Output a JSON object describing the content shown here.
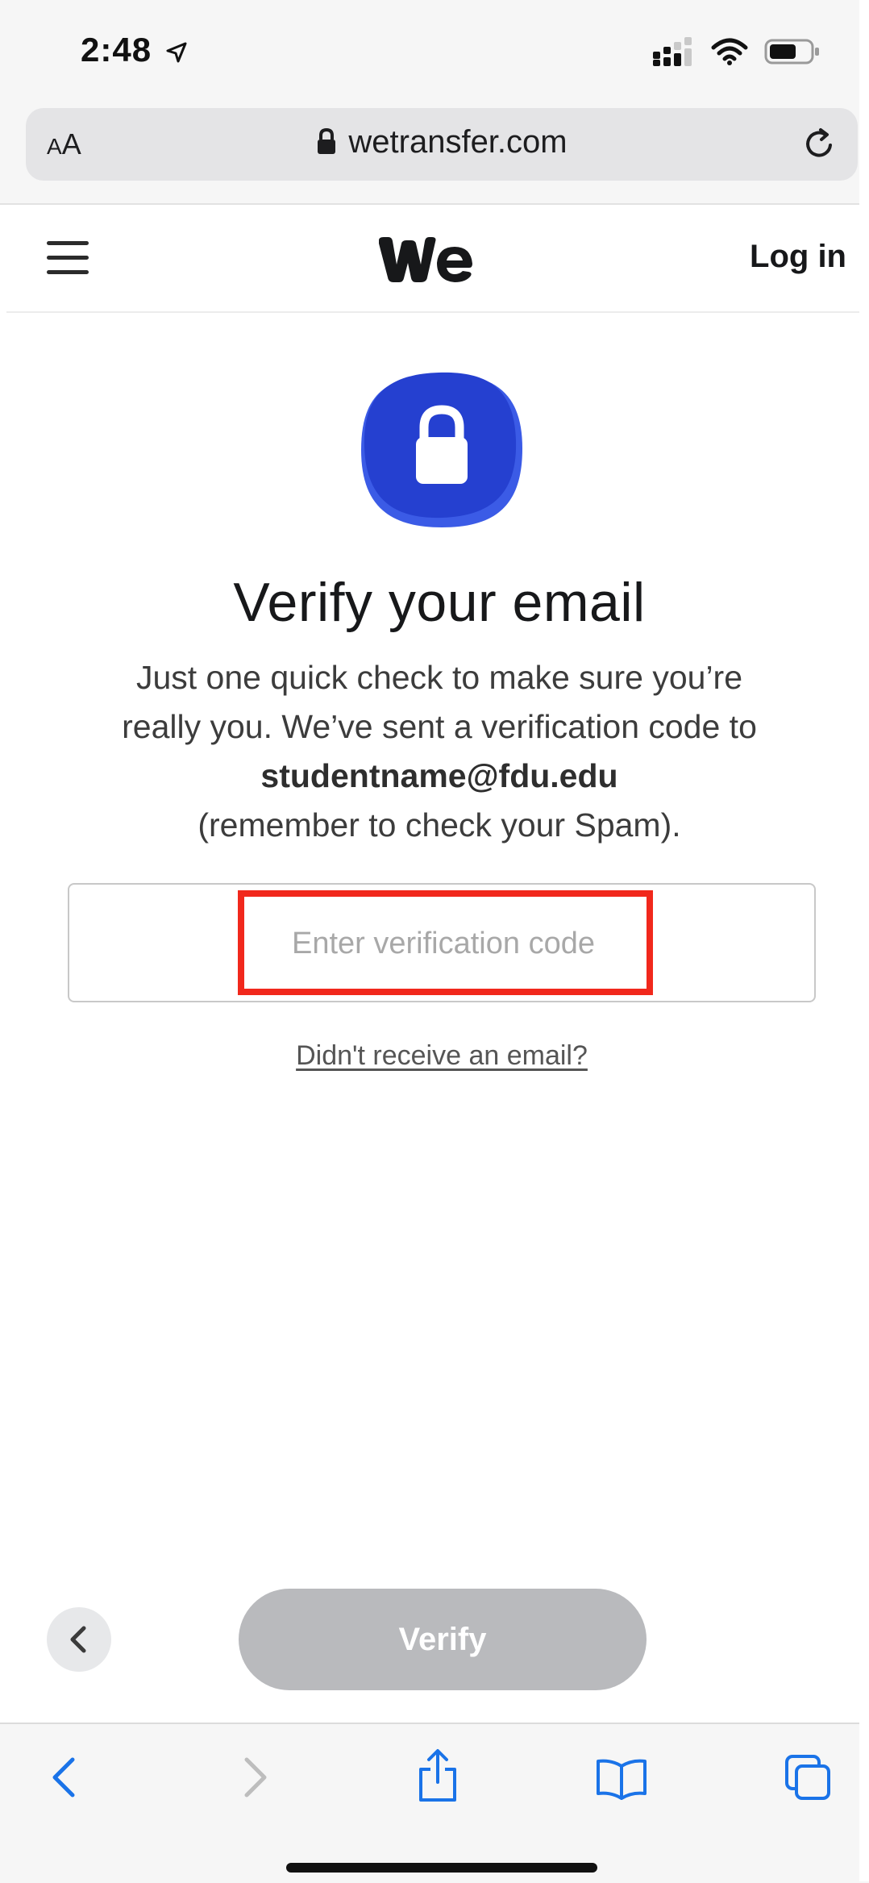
{
  "status_bar": {
    "time": "2:48"
  },
  "browser": {
    "text_size_label_small": "A",
    "text_size_label_large": "A",
    "url": "wetransfer.com"
  },
  "header": {
    "login_label": "Log in"
  },
  "main": {
    "title": "Verify your email",
    "description_line1": "Just one quick check to make sure you’re",
    "description_line2": "really you. We’ve sent a verification code to",
    "email": "studentname@fdu.edu",
    "description_line4": "(remember to check your Spam).",
    "code_placeholder": "Enter verification code",
    "code_value": "",
    "resend_link": "Didn't receive an email?",
    "verify_label": "Verify"
  },
  "colors": {
    "brand_blue": "#2c48d8",
    "highlight_red": "#f1281c",
    "button_disabled": "#b9babd",
    "safari_blue": "#1a73e8"
  },
  "icons": {
    "status": [
      "location-arrow-icon",
      "cellular-signal-icon",
      "wifi-icon",
      "battery-icon"
    ],
    "browser": [
      "lock-icon",
      "reload-icon"
    ],
    "toolbar": [
      "back-arrow-icon",
      "forward-arrow-icon",
      "share-icon",
      "bookmarks-icon",
      "tabs-icon"
    ]
  }
}
